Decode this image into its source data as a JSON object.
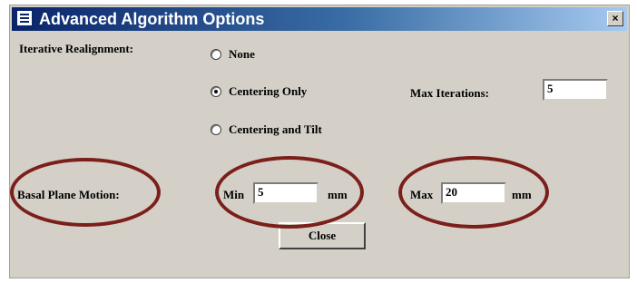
{
  "window": {
    "title": "Advanced Algorithm Options",
    "close_glyph": "×",
    "app_icon": "application-window-icon"
  },
  "iterative": {
    "label": "Iterative Realignment:",
    "options": [
      {
        "label": "None",
        "checked": false
      },
      {
        "label": "Centering Only",
        "checked": true
      },
      {
        "label": "Centering and Tilt",
        "checked": false
      }
    ],
    "max_iterations_label": "Max Iterations:",
    "max_iterations_value": "5"
  },
  "basal": {
    "label": "Basal Plane Motion:",
    "min_label": "Min",
    "min_value": "5",
    "min_unit": "mm",
    "max_label": "Max",
    "max_value": "20",
    "max_unit": "mm"
  },
  "close_button_label": "Close",
  "annotation_color": "#7b1f1a"
}
